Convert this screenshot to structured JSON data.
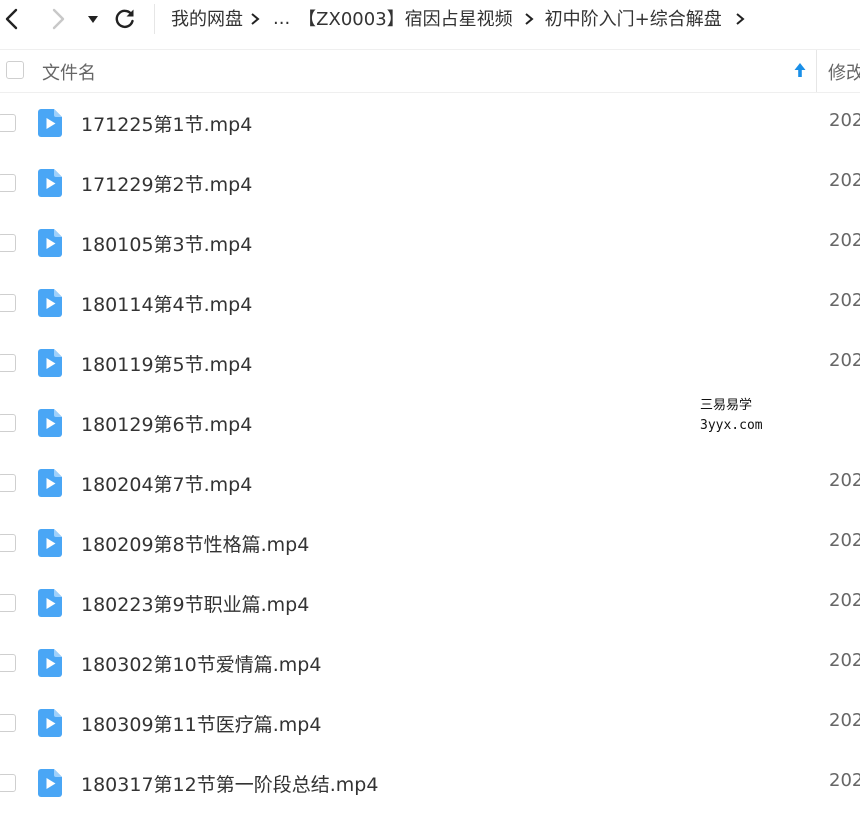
{
  "breadcrumb": {
    "items": [
      "我的网盘",
      "...",
      "【ZX0003】宿因占星视频",
      "初中阶入门+综合解盘"
    ]
  },
  "header": {
    "name_label": "文件名",
    "modified_label": "修改"
  },
  "files": [
    {
      "name": "171225第1节.mp4",
      "date": "202"
    },
    {
      "name": "171229第2节.mp4",
      "date": "202"
    },
    {
      "name": "180105第3节.mp4",
      "date": "202"
    },
    {
      "name": "180114第4节.mp4",
      "date": "202"
    },
    {
      "name": "180119第5节.mp4",
      "date": "202"
    },
    {
      "name": "180129第6节.mp4",
      "date": ""
    },
    {
      "name": "180204第7节.mp4",
      "date": "202"
    },
    {
      "name": "180209第8节性格篇.mp4",
      "date": "202"
    },
    {
      "name": "180223第9节职业篇.mp4",
      "date": "202"
    },
    {
      "name": "180302第10节爱情篇.mp4",
      "date": "202"
    },
    {
      "name": "180309第11节医疗篇.mp4",
      "date": "202"
    },
    {
      "name": "180317第12节第一阶段总结.mp4",
      "date": "202"
    }
  ],
  "watermark": {
    "line1": "三易易学",
    "line2": "3yyx.com"
  },
  "colors": {
    "icon_blue": "#4aa6f5",
    "sort_arrow": "#1a8fe8"
  },
  "icons": {
    "back": "chevron-left-icon",
    "forward": "chevron-right-icon",
    "history": "caret-down-icon",
    "refresh": "refresh-icon",
    "video": "video-file-icon",
    "sort": "sort-up-arrow-icon"
  }
}
